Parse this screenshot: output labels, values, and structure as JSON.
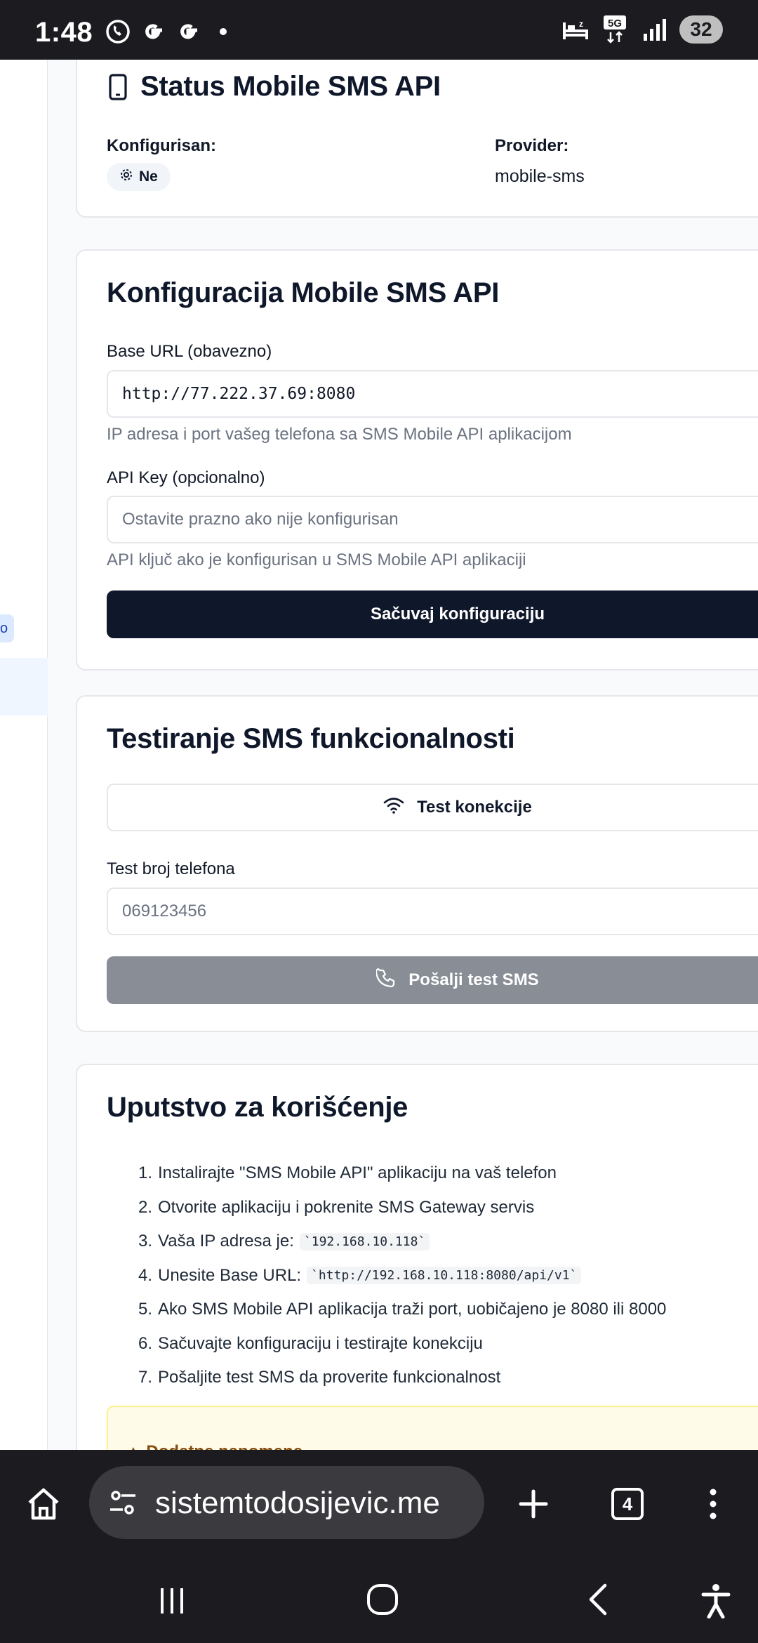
{
  "status_bar": {
    "time": "1:48",
    "network": "5G",
    "battery": "32",
    "icons": [
      "viber-icon",
      "google-icon",
      "google-icon",
      "dot-icon",
      "sleep-icon",
      "5g-icon",
      "signal-icon",
      "battery-icon"
    ]
  },
  "status_card": {
    "title": "Status Mobile SMS API",
    "icon": "smartphone-icon",
    "configured_label": "Konfigurisan:",
    "configured_value": "Ne",
    "provider_label": "Provider:",
    "provider_value": "mobile-sms"
  },
  "config_card": {
    "title": "Konfiguracija Mobile SMS API",
    "base_url_label": "Base URL (obavezno)",
    "base_url_value": "http://77.222.37.69:8080",
    "base_url_hint": "IP adresa i port vašeg telefona sa SMS Mobile API aplikacijom",
    "api_key_label": "API Key (opcionalno)",
    "api_key_placeholder": "Ostavite prazno ako nije konfigurisan",
    "api_key_hint": "API ključ ako je konfigurisan u SMS Mobile API aplikaciji",
    "save_button": "Sačuvaj konfiguraciju"
  },
  "test_card": {
    "title": "Testiranje SMS funkcionalnosti",
    "test_connection_button": "Test konekcije",
    "phone_label": "Test broj telefona",
    "phone_placeholder": "069123456",
    "send_button": "Pošalji test SMS"
  },
  "instructions_card": {
    "title": "Uputstvo za korišćenje",
    "steps": [
      {
        "num": "1.",
        "text": "Instalirajte \"SMS Mobile API\" aplikaciju na vaš telefon",
        "code": ""
      },
      {
        "num": "2.",
        "text": "Otvorite aplikaciju i pokrenite SMS Gateway servis",
        "code": ""
      },
      {
        "num": "3.",
        "text": "Vaša IP adresa je:",
        "code": "`192.168.10.118`"
      },
      {
        "num": "4.",
        "text": "Unesite Base URL:",
        "code": "`http://192.168.10.118:8080/api/v1`"
      },
      {
        "num": "5.",
        "text": "Ako SMS Mobile API aplikacija traži port, uobičajeno je 8080 ili 8000",
        "code": ""
      },
      {
        "num": "6.",
        "text": "Sačuvajte konfiguraciju i testirajte konekciju",
        "code": ""
      },
      {
        "num": "7.",
        "text": "Pošaljite test SMS da proverite funkcionalnost",
        "code": ""
      }
    ],
    "warning_text": "Dodatne napomene"
  },
  "sidebar": {
    "badge": "o"
  },
  "browser": {
    "url": "sistemtodosijevic.me",
    "tab_count": "4"
  },
  "colors": {
    "primary": "#0f172a",
    "disabled": "#888d96",
    "muted_text": "#6b7280",
    "border": "#e5e7eb",
    "system_bar": "#1c1c20"
  }
}
